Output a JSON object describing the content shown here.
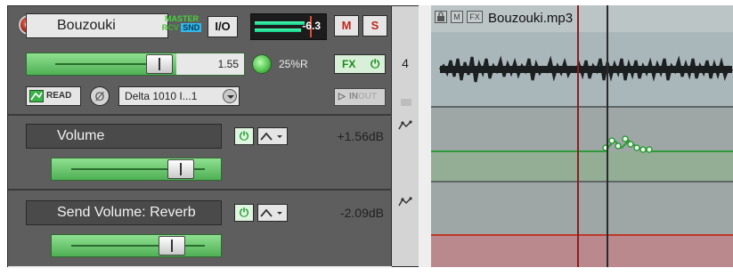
{
  "track": {
    "name": "Bouzouki",
    "master_label": "MASTER",
    "rcv_label": "RCV",
    "snd_label": "SND",
    "io_label": "I/O",
    "meter_value": "-6.3",
    "mute_label": "M",
    "solo_label": "S",
    "volume_readout": "1.55",
    "volume_level": 0.62,
    "pan_value": "25%R",
    "fx_label": "FX",
    "automation_mode": "READ",
    "phase_symbol": "Ø",
    "input_name": "Delta 1010 I...1",
    "monitor_label": "IN",
    "monitor_label_dim": "OUT",
    "track_number": "4"
  },
  "envelopes": [
    {
      "name": "Volume",
      "value": "+1.56dB",
      "level": 0.62
    },
    {
      "name": "Send Volume: Reverb",
      "value": "-2.09dB",
      "level": 0.55
    }
  ],
  "media_item": {
    "title": "Bouzouki.mp3",
    "lock_icon": "lock-icon",
    "mute_icon_label": "M",
    "fx_icon_label": "FX"
  },
  "colors": {
    "meter": "#2be39a",
    "record_arm": "#c0392b",
    "volume_envelope": "#2f9a3a",
    "send_envelope": "#c0392b",
    "playhead": "#8a1f1f",
    "edit_cursor": "#2a2a2a"
  }
}
